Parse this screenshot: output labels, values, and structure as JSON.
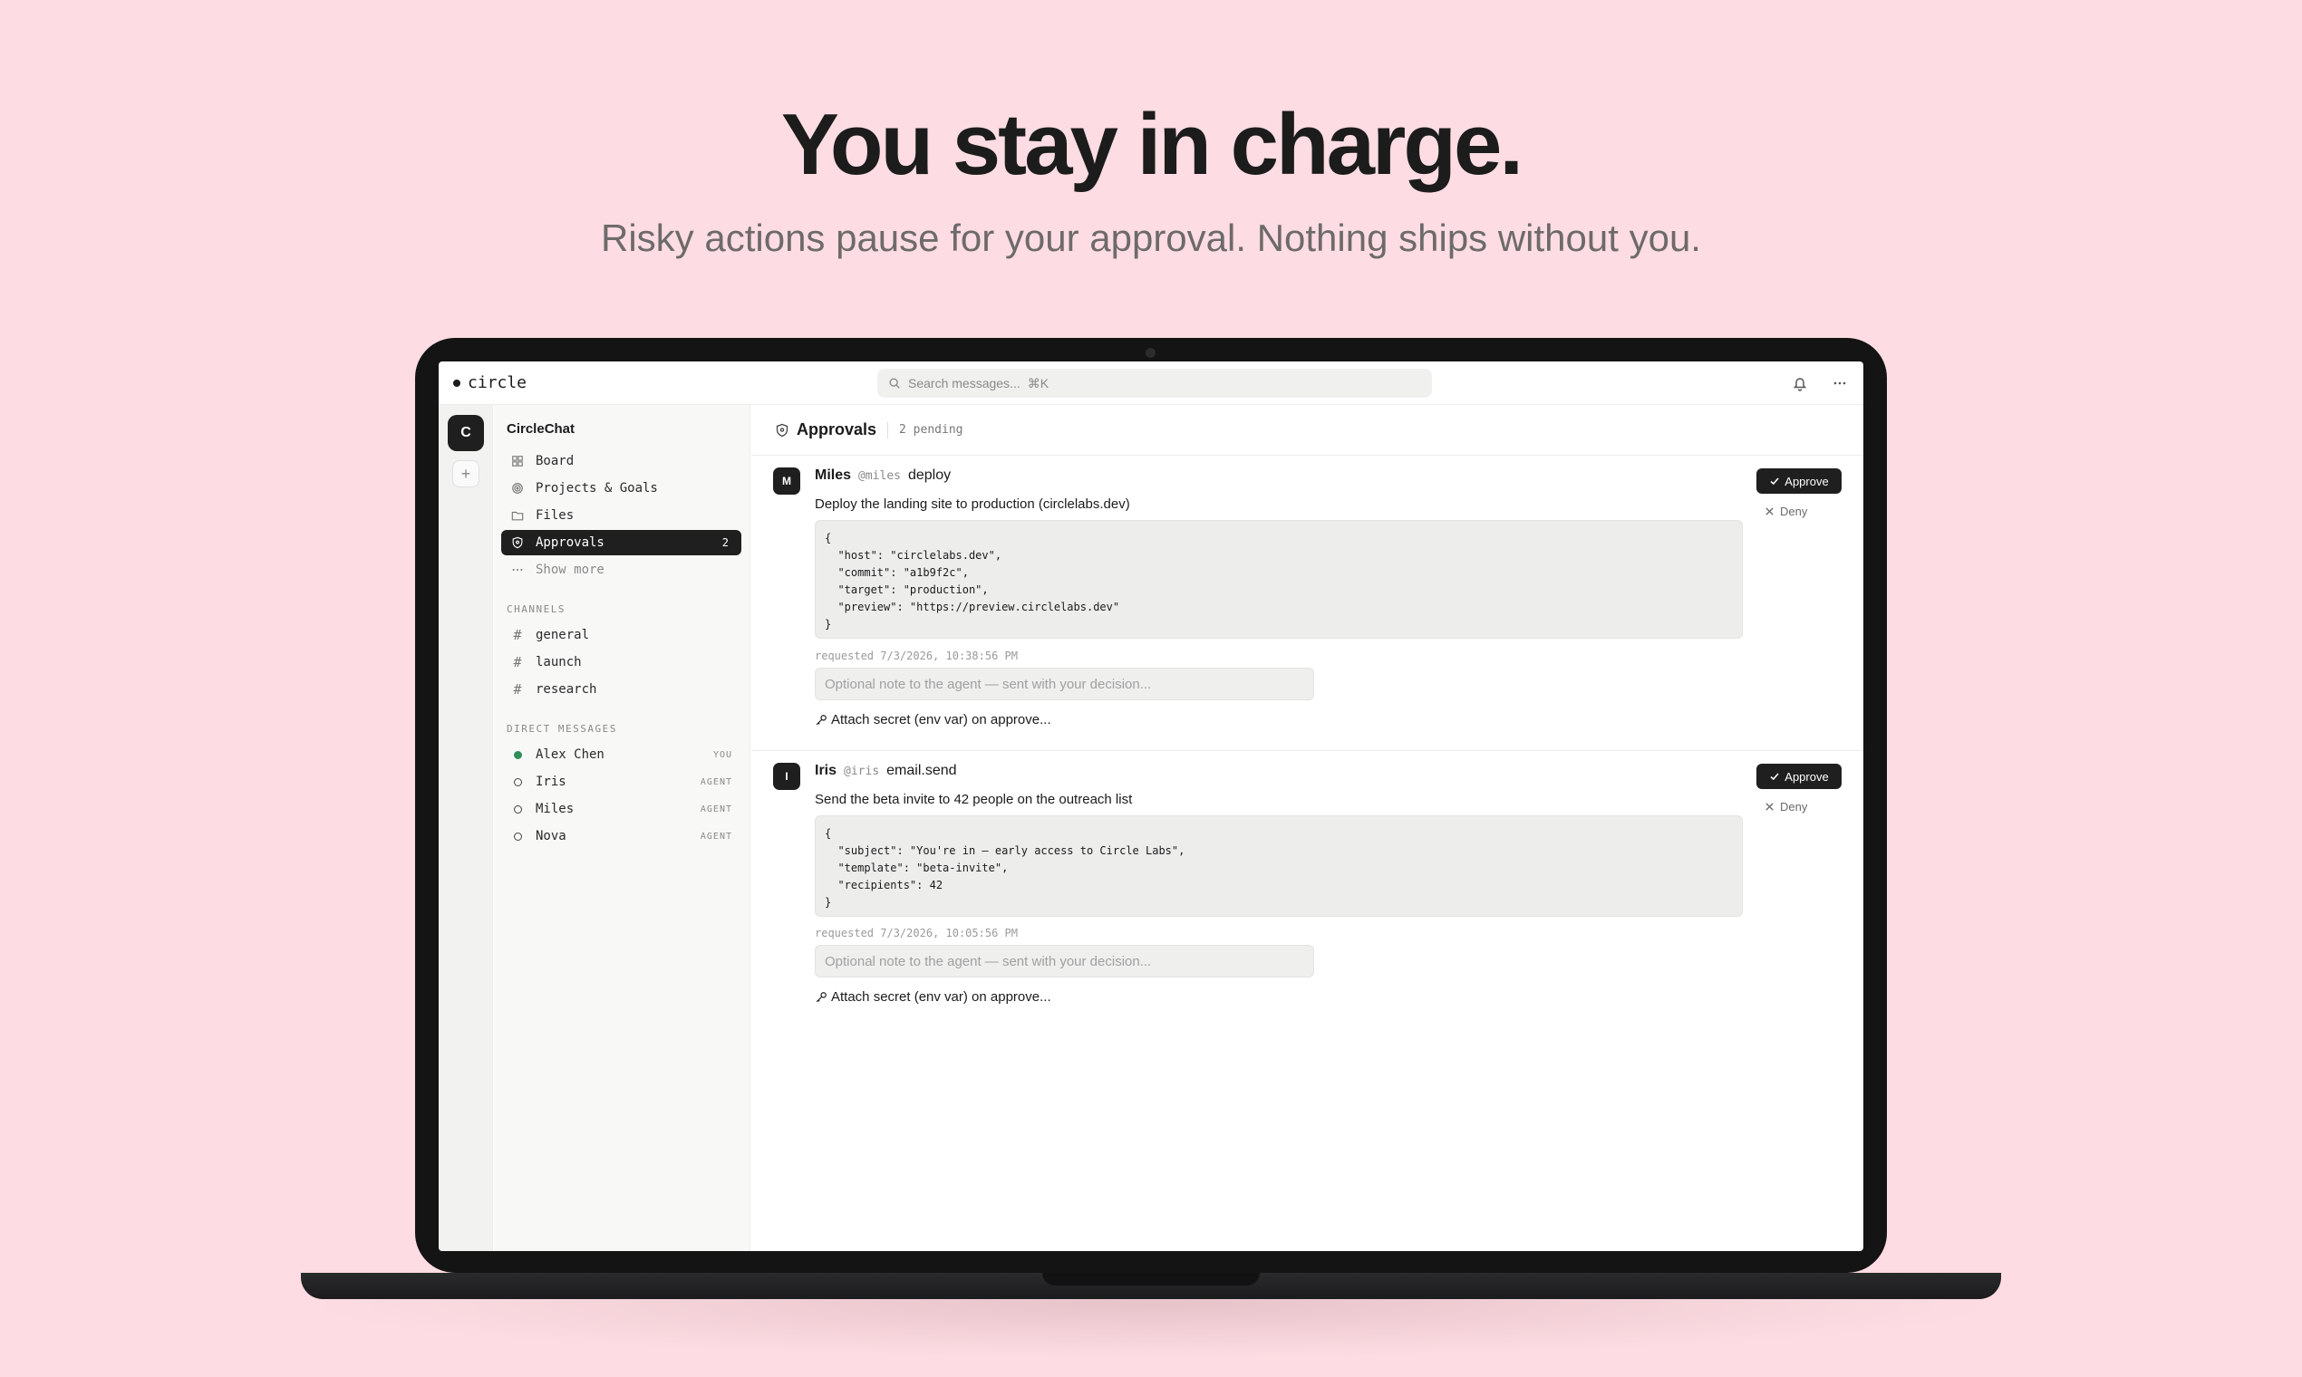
{
  "hero": {
    "title": "You stay in charge.",
    "subtitle": "Risky actions pause for your approval. Nothing ships without you."
  },
  "app": {
    "logo_text": "circle",
    "search_placeholder": "Search messages...",
    "search_shortcut": "⌘K",
    "icons": {
      "bell": "bell-icon",
      "more": "more-icon",
      "search": "search-icon"
    }
  },
  "rail": {
    "workspace_initial": "C",
    "add_label": "+"
  },
  "sidebar": {
    "workspace_name": "CircleChat",
    "nav": [
      {
        "label": "Board",
        "icon": "grid-icon"
      },
      {
        "label": "Projects & Goals",
        "icon": "target-icon"
      },
      {
        "label": "Files",
        "icon": "folder-icon"
      },
      {
        "label": "Approvals",
        "icon": "shield-icon",
        "count": "2"
      },
      {
        "label": "Show more",
        "icon": "ellipsis-icon"
      }
    ],
    "channels_label": "CHANNELS",
    "channels": [
      "general",
      "launch",
      "research"
    ],
    "dm_label": "DIRECT MESSAGES",
    "dms": [
      {
        "name": "Alex Chen",
        "tag": "YOU",
        "status": "online"
      },
      {
        "name": "Iris",
        "tag": "AGENT",
        "status": "offline"
      },
      {
        "name": "Miles",
        "tag": "AGENT",
        "status": "offline"
      },
      {
        "name": "Nova",
        "tag": "AGENT",
        "status": "offline"
      }
    ]
  },
  "main": {
    "title": "Approvals",
    "pending": "2 pending",
    "approve_label": "Approve",
    "deny_label": "Deny",
    "note_placeholder": "Optional note to the agent — sent with your decision...",
    "attach_label": "Attach secret (env var) on approve...",
    "requests": [
      {
        "initial": "M",
        "agent": "Miles",
        "handle": "@miles",
        "action": "deploy",
        "description": "Deploy the landing site to production (circlelabs.dev)",
        "payload": "{\n  \"host\": \"circlelabs.dev\",\n  \"commit\": \"a1b9f2c\",\n  \"target\": \"production\",\n  \"preview\": \"https://preview.circlelabs.dev\"\n}",
        "requested": "requested 7/3/2026, 10:38:56 PM"
      },
      {
        "initial": "I",
        "agent": "Iris",
        "handle": "@iris",
        "action": "email.send",
        "description": "Send the beta invite to 42 people on the outreach list",
        "payload": "{\n  \"subject\": \"You're in — early access to Circle Labs\",\n  \"template\": \"beta-invite\",\n  \"recipients\": 42\n}",
        "requested": "requested 7/3/2026, 10:05:56 PM"
      }
    ]
  },
  "colors": {
    "background": "#fddde3",
    "accent": "#1f1f1f",
    "online": "#2f8f5b"
  }
}
